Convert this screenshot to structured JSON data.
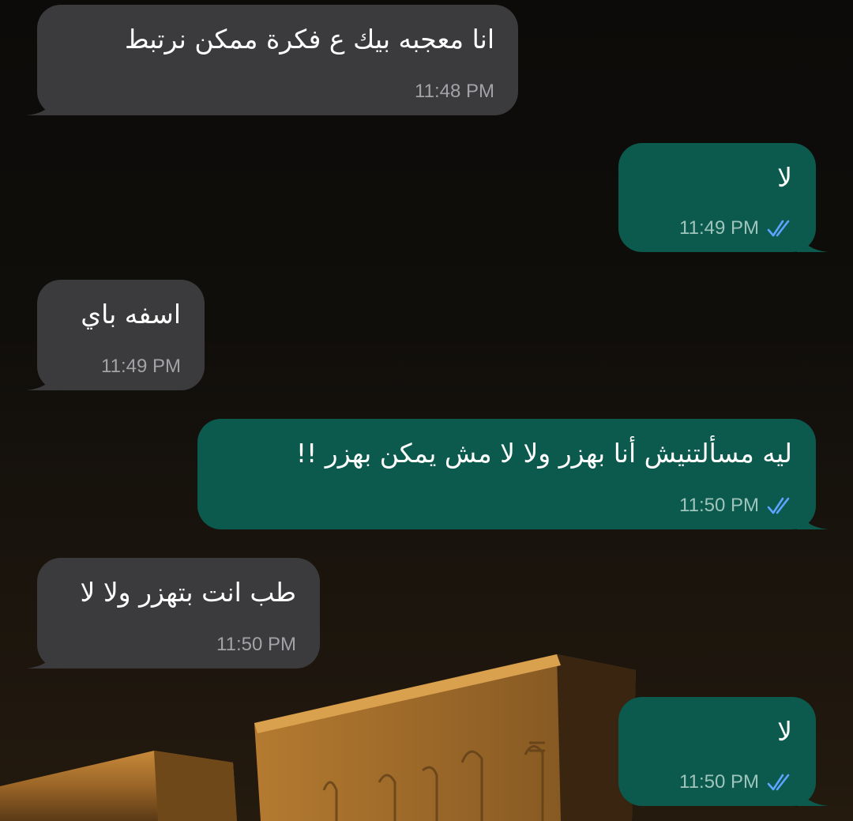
{
  "colors": {
    "incoming_bubble": "#3b3b3e",
    "outgoing_bubble": "#0b5a4d",
    "read_receipt": "#5ea3ff",
    "text": "#ffffff",
    "time_in": "#a3a3a7",
    "time_out": "#9fc4bc"
  },
  "messages": [
    {
      "direction": "incoming",
      "text": "انا معجبه بيك ع فكرة ممكن نرتبط",
      "time": "11:48 PM"
    },
    {
      "direction": "outgoing",
      "text": "لا",
      "time": "11:49 PM",
      "status_icon": "double-check-icon"
    },
    {
      "direction": "incoming",
      "text": "اسفه باي",
      "time": "11:49 PM"
    },
    {
      "direction": "outgoing",
      "text": "ليه مسألتنيش أنا بهزر ولا لا مش يمكن بهزر !!",
      "time": "11:50 PM",
      "status_icon": "double-check-icon"
    },
    {
      "direction": "incoming",
      "text": "طب انت بتهزر ولا لا",
      "time": "11:50 PM"
    },
    {
      "direction": "outgoing",
      "text": "لا",
      "time": "11:50 PM",
      "status_icon": "double-check-icon"
    }
  ]
}
